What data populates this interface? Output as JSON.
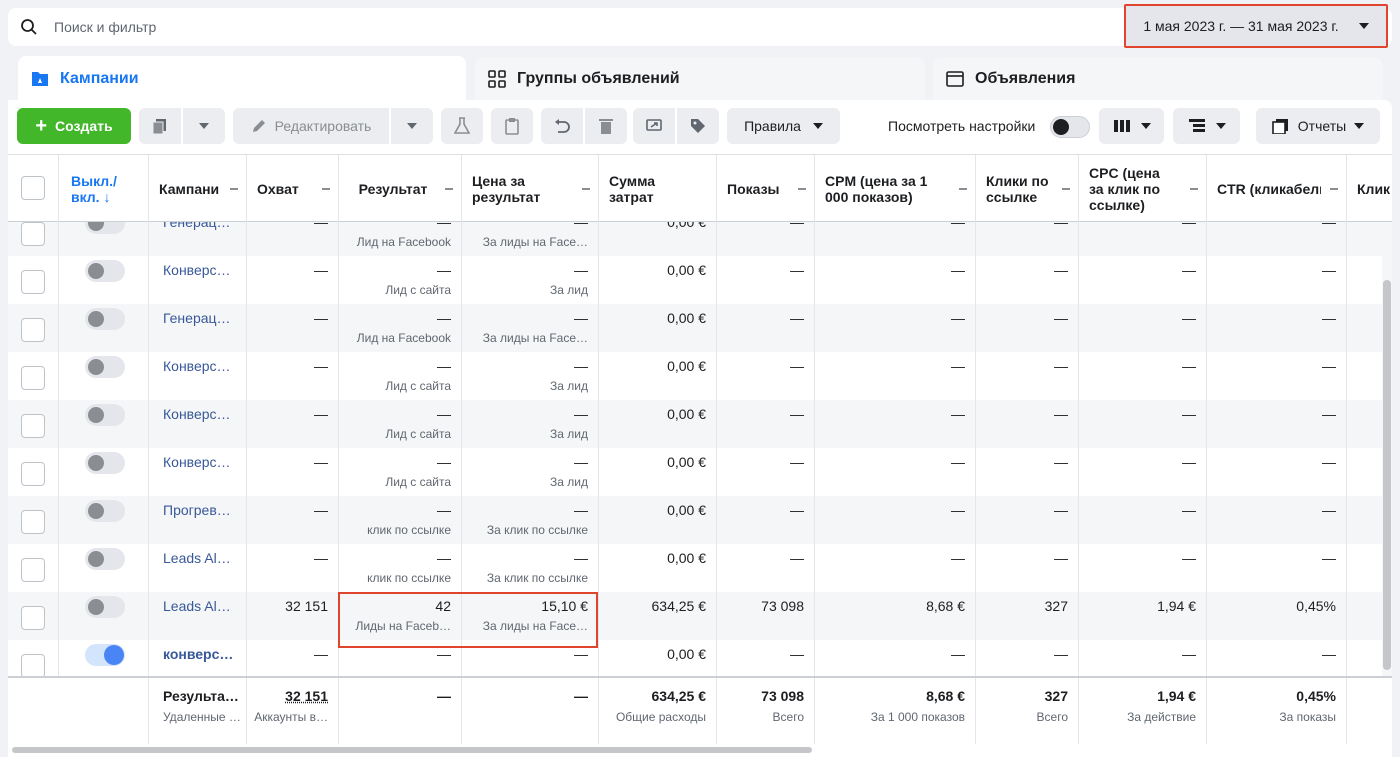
{
  "search": {
    "placeholder": "Поиск и фильтр"
  },
  "date_range": {
    "label": "1 мая 2023 г. — 31 мая 2023 г."
  },
  "tabs": [
    {
      "label": "Кампании",
      "icon": "campaign-flag-icon",
      "active": true
    },
    {
      "label": "Группы объявлений",
      "icon": "grid-icon",
      "active": false
    },
    {
      "label": "Объявления",
      "icon": "ad-window-icon",
      "active": false
    }
  ],
  "toolbar": {
    "create_label": "Создать",
    "edit_label": "Редактировать",
    "rules_label": "Правила",
    "view_settings_label": "Посмотреть настройки",
    "reports_label": "Отчеты"
  },
  "columns": [
    {
      "label": "Выкл./ вкл. ↓"
    },
    {
      "label": "Кампани"
    },
    {
      "label": "Охват"
    },
    {
      "label": "Результат"
    },
    {
      "label": "Цена за результат"
    },
    {
      "label": "Сумма затрат"
    },
    {
      "label": "Показы"
    },
    {
      "label": "CPM (цена за 1 000 показов)"
    },
    {
      "label": "Клики по ссылке"
    },
    {
      "label": "CPC (цена за клик по ссылке)"
    },
    {
      "label": "CTR (кликабельнос"
    },
    {
      "label": "Клик"
    }
  ],
  "rows": [
    {
      "name": "Генерац…",
      "reach": "—",
      "result": "—",
      "result_sub": "Лид на Facebook",
      "cost": "—",
      "cost_sub": "За лиды на Face…",
      "spend": "0,00 €",
      "impressions": "—",
      "cpm": "—",
      "clicks": "—",
      "cpc": "—",
      "ctr": "—",
      "on": false
    },
    {
      "name": "Конверс…",
      "reach": "—",
      "result": "—",
      "result_sub": "Лид с сайта",
      "cost": "—",
      "cost_sub": "За лид",
      "spend": "0,00 €",
      "impressions": "—",
      "cpm": "—",
      "clicks": "—",
      "cpc": "—",
      "ctr": "—",
      "on": false
    },
    {
      "name": "Генерац…",
      "reach": "—",
      "result": "—",
      "result_sub": "Лид на Facebook",
      "cost": "—",
      "cost_sub": "За лиды на Face…",
      "spend": "0,00 €",
      "impressions": "—",
      "cpm": "—",
      "clicks": "—",
      "cpc": "—",
      "ctr": "—",
      "on": false
    },
    {
      "name": "Конверс…",
      "reach": "—",
      "result": "—",
      "result_sub": "Лид с сайта",
      "cost": "—",
      "cost_sub": "За лид",
      "spend": "0,00 €",
      "impressions": "—",
      "cpm": "—",
      "clicks": "—",
      "cpc": "—",
      "ctr": "—",
      "on": false
    },
    {
      "name": "Конверс…",
      "reach": "—",
      "result": "—",
      "result_sub": "Лид с сайта",
      "cost": "—",
      "cost_sub": "За лид",
      "spend": "0,00 €",
      "impressions": "—",
      "cpm": "—",
      "clicks": "—",
      "cpc": "—",
      "ctr": "—",
      "on": false
    },
    {
      "name": "Конверс…",
      "reach": "—",
      "result": "—",
      "result_sub": "Лид с сайта",
      "cost": "—",
      "cost_sub": "За лид",
      "spend": "0,00 €",
      "impressions": "—",
      "cpm": "—",
      "clicks": "—",
      "cpc": "—",
      "ctr": "—",
      "on": false
    },
    {
      "name": "Прогрев…",
      "reach": "—",
      "result": "—",
      "result_sub": "клик по ссылке",
      "cost": "—",
      "cost_sub": "За клик по ссылке",
      "spend": "0,00 €",
      "impressions": "—",
      "cpm": "—",
      "clicks": "—",
      "cpc": "—",
      "ctr": "—",
      "on": false
    },
    {
      "name": "Leads Al…",
      "reach": "—",
      "result": "—",
      "result_sub": "клик по ссылке",
      "cost": "—",
      "cost_sub": "За клик по ссылке",
      "spend": "0,00 €",
      "impressions": "—",
      "cpm": "—",
      "clicks": "—",
      "cpc": "—",
      "ctr": "—",
      "on": false
    },
    {
      "name": "Leads Al…",
      "reach": "32 151",
      "result": "42",
      "result_sub": "Лиды на Faceb…",
      "cost": "15,10 €",
      "cost_sub": "За лиды на Face…",
      "spend": "634,25 €",
      "impressions": "73 098",
      "cpm": "8,68 €",
      "clicks": "327",
      "cpc": "1,94 €",
      "ctr": "0,45%",
      "on": false
    },
    {
      "name": "конверс…",
      "reach": "—",
      "result": "—",
      "result_sub": "",
      "cost": "—",
      "cost_sub": "",
      "spend": "0,00 €",
      "impressions": "—",
      "cpm": "—",
      "clicks": "—",
      "cpc": "—",
      "ctr": "—",
      "on": true
    }
  ],
  "totals": {
    "name": "Результа…",
    "name_sub": "Удаленные …",
    "reach": "32 151",
    "reach_sub": "Аккаунты в…",
    "result": "—",
    "cost": "—",
    "spend": "634,25 €",
    "spend_sub": "Общие расходы",
    "impressions": "73 098",
    "impressions_sub": "Всего",
    "cpm": "8,68 €",
    "cpm_sub": "За 1 000 показов",
    "clicks": "327",
    "clicks_sub": "Всего",
    "cpc": "1,94 €",
    "cpc_sub": "За действие",
    "ctr": "0,45%",
    "ctr_sub": "За показы"
  }
}
